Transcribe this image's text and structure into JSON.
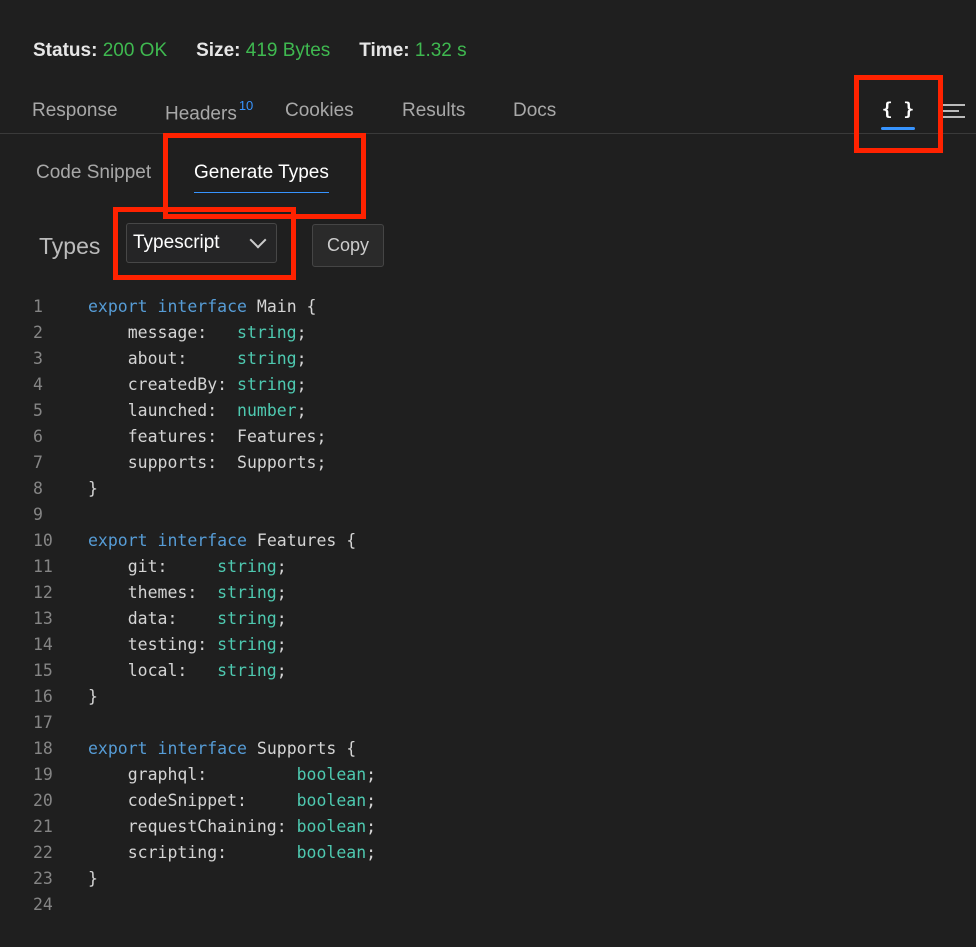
{
  "status": {
    "status_label": "Status:",
    "status_value": "200 OK",
    "size_label": "Size:",
    "size_value": "419 Bytes",
    "time_label": "Time:",
    "time_value": "1.32 s"
  },
  "tabs": {
    "response": "Response",
    "headers": "Headers",
    "headers_count": "10",
    "cookies": "Cookies",
    "results": "Results",
    "docs": "Docs",
    "braces_icon": "{ }"
  },
  "subtabs": {
    "code_snippet": "Code Snippet",
    "generate_types": "Generate Types"
  },
  "types": {
    "label": "Types",
    "selected": "Typescript",
    "copy": "Copy"
  },
  "code": [
    {
      "n": "1",
      "kw": "export interface ",
      "name": "Main {"
    },
    {
      "n": "2",
      "field": "    message:   ",
      "type": "string",
      ";": ";"
    },
    {
      "n": "3",
      "field": "    about:     ",
      "type": "string"
    },
    {
      "n": "4",
      "field": "    createdBy: ",
      "type": "string"
    },
    {
      "n": "5",
      "field": "    launched:  ",
      "type": "number"
    },
    {
      "n": "6",
      "field": "    features:  ",
      "plain": "Features;"
    },
    {
      "n": "7",
      "field": "    supports:  ",
      "plain": "Supports;"
    },
    {
      "n": "8",
      "plain": "}"
    },
    {
      "n": "9"
    },
    {
      "n": "10",
      "kw": "export interface ",
      "name": "Features {"
    },
    {
      "n": "11",
      "field": "    git:     ",
      "type": "string"
    },
    {
      "n": "12",
      "field": "    themes:  ",
      "type": "string"
    },
    {
      "n": "13",
      "field": "    data:    ",
      "type": "string"
    },
    {
      "n": "14",
      "field": "    testing: ",
      "type": "string"
    },
    {
      "n": "15",
      "field": "    local:   ",
      "type": "string"
    },
    {
      "n": "16",
      "plain": "}"
    },
    {
      "n": "17"
    },
    {
      "n": "18",
      "kw": "export interface ",
      "name": "Supports {"
    },
    {
      "n": "19",
      "field": "    graphql:         ",
      "type": "boolean"
    },
    {
      "n": "20",
      "field": "    codeSnippet:     ",
      "type": "boolean"
    },
    {
      "n": "21",
      "field": "    requestChaining: ",
      "type": "boolean"
    },
    {
      "n": "22",
      "field": "    scripting:       ",
      "type": "boolean"
    },
    {
      "n": "23",
      "plain": "}"
    },
    {
      "n": "24"
    }
  ],
  "colors": {
    "accent": "#3794ff",
    "success": "#3fb950",
    "highlight": "#ff2200",
    "type": "#4ec9b0",
    "keyword": "#569cd6"
  }
}
